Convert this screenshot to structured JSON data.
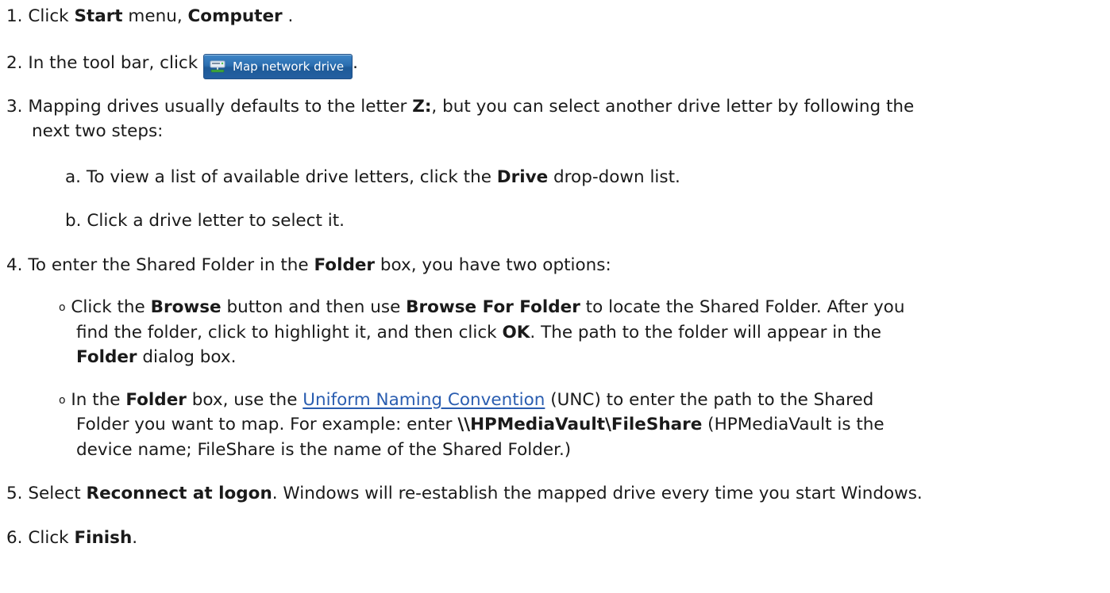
{
  "steps": {
    "s1": {
      "num": "1.",
      "pre": "Click ",
      "b1": "Start",
      "mid": " menu, ",
      "b2": "Computer",
      "post": " ."
    },
    "s2": {
      "num": "2.",
      "pre": "In the tool bar, click ",
      "button_label": "Map network drive",
      "post": "."
    },
    "s3": {
      "num": "3.",
      "pre": "Mapping drives usually defaults to the letter ",
      "b1": "Z:",
      "post": ", but you can select another drive letter by following the",
      "line2": "next two steps:",
      "a": {
        "label": "a.",
        "pre": "To view a list of available drive letters, click the ",
        "b1": "Drive",
        "post": " drop-down list."
      },
      "b": {
        "label": "b.",
        "text": "Click a drive letter to select it."
      }
    },
    "s4": {
      "num": "4.",
      "pre": "To enter the Shared Folder in the ",
      "b1": "Folder",
      "post": " box, you have two options:",
      "opt1": {
        "bullet": "o",
        "l1_pre": "Click the ",
        "l1_b1": "Browse",
        "l1_mid": " button and then use ",
        "l1_b2": "Browse For Folder",
        "l1_post": " to locate the Shared Folder. After you",
        "l2_pre": "find the folder, click to highlight it, and then click ",
        "l2_b1": "OK",
        "l2_post": ". The path to the folder will appear in the",
        "l3_b1": "Folder",
        "l3_post": " dialog box."
      },
      "opt2": {
        "bullet": "o",
        "l1_pre": "In the ",
        "l1_b1": "Folder",
        "l1_mid": " box, use the ",
        "l1_link": "Uniform Naming Convention",
        "l1_post": " (UNC) to enter the path to the Shared",
        "l2_pre": "Folder you want to map. For example: enter ",
        "l2_b1": "\\\\HPMediaVault\\FileShare",
        "l2_post": " (HPMediaVault is the",
        "l3": "device name; FileShare is the name of the Shared Folder.)"
      }
    },
    "s5": {
      "num": "5.",
      "pre": "Select ",
      "b1": "Reconnect at logon",
      "post": ". Windows will re-establish the mapped drive every time you start Windows."
    },
    "s6": {
      "num": "6.",
      "pre": "Click ",
      "b1": "Finish",
      "post": "."
    }
  },
  "colors": {
    "text": "#1a1a1a",
    "link": "#2a5db0",
    "button_bg": "#2b6eb0"
  },
  "icons": {
    "map_drive": "network-drive-icon"
  }
}
